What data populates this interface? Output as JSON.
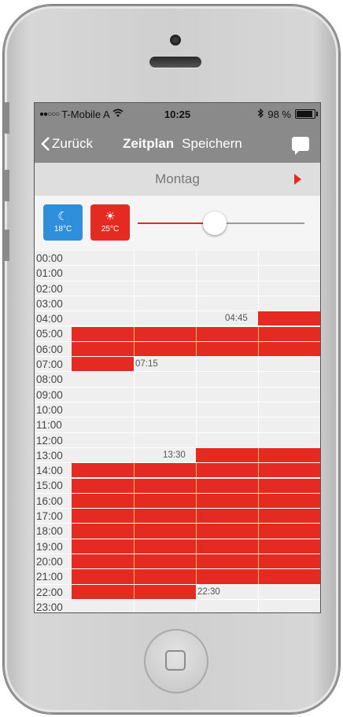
{
  "status_bar": {
    "carrier": "T-Mobile A",
    "time": "10:25",
    "battery": "98 %",
    "battery_level": 0.98
  },
  "nav": {
    "back_label": "Zurück",
    "title": "Zeitplan",
    "save_label": "Speichern"
  },
  "day": {
    "label": "Montag"
  },
  "temps": {
    "cool_label": "18°C",
    "heat_label": "25°C",
    "cool_color": "#2f8fdb",
    "heat_color": "#e52a22",
    "slider_fraction": 0.46
  },
  "hours": [
    "00:00",
    "01:00",
    "02:00",
    "03:00",
    "04:00",
    "05:00",
    "06:00",
    "07:00",
    "08:00",
    "09:00",
    "10:00",
    "11:00",
    "12:00",
    "13:00",
    "14:00",
    "15:00",
    "16:00",
    "17:00",
    "18:00",
    "19:00",
    "20:00",
    "21:00",
    "22:00",
    "23:00"
  ],
  "schedule": {
    "blocks": [
      {
        "start": "04:45",
        "end": "07:15"
      },
      {
        "start": "13:30",
        "end": "22:30"
      }
    ],
    "labels": [
      "04:45",
      "07:15",
      "13:30",
      "22:30"
    ]
  }
}
